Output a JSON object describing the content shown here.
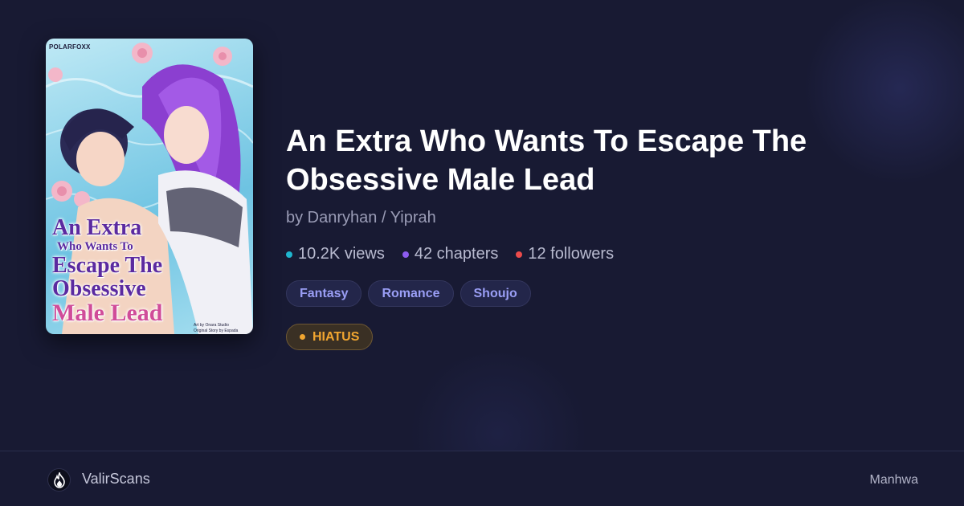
{
  "cover": {
    "publisher": "POLARFOXX",
    "title_lines": [
      "An Extra",
      "Who Wants To",
      "Escape The",
      "Obsessive",
      "Male Lead"
    ],
    "credits_art": "Art by Onara Studio",
    "credits_story": "Original Story by Espada"
  },
  "title": "An Extra Who Wants To Escape The Obsessive Male Lead",
  "authors": "by Danryhan / Yiprah",
  "stats": [
    {
      "label": "10.2K views",
      "color": "#1fb6cf"
    },
    {
      "label": "42 chapters",
      "color": "#8e5cf0"
    },
    {
      "label": "12 followers",
      "color": "#ec4b4b"
    }
  ],
  "tags": [
    "Fantasy",
    "Romance",
    "Shoujo"
  ],
  "status": {
    "label": "HIATUS",
    "color": "#f1a630"
  },
  "footer": {
    "site_name": "ValirScans",
    "logo_icon": "flame-icon",
    "type": "Manhwa"
  }
}
